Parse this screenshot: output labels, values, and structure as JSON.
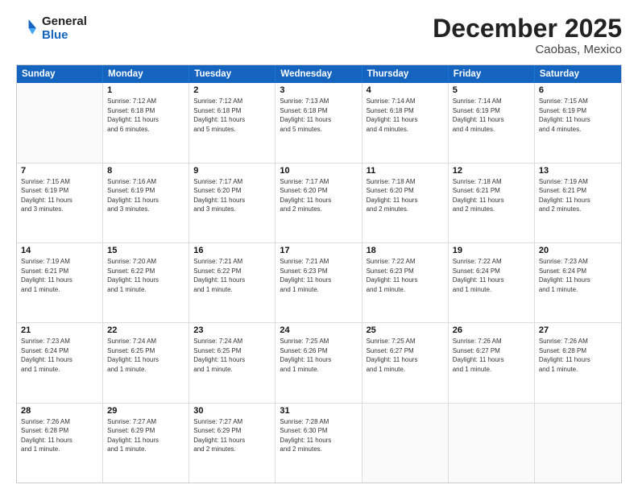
{
  "logo": {
    "line1": "General",
    "line2": "Blue"
  },
  "title": "December 2025",
  "subtitle": "Caobas, Mexico",
  "header_days": [
    "Sunday",
    "Monday",
    "Tuesday",
    "Wednesday",
    "Thursday",
    "Friday",
    "Saturday"
  ],
  "weeks": [
    [
      {
        "day": "",
        "lines": []
      },
      {
        "day": "1",
        "lines": [
          "Sunrise: 7:12 AM",
          "Sunset: 6:18 PM",
          "Daylight: 11 hours",
          "and 6 minutes."
        ]
      },
      {
        "day": "2",
        "lines": [
          "Sunrise: 7:12 AM",
          "Sunset: 6:18 PM",
          "Daylight: 11 hours",
          "and 5 minutes."
        ]
      },
      {
        "day": "3",
        "lines": [
          "Sunrise: 7:13 AM",
          "Sunset: 6:18 PM",
          "Daylight: 11 hours",
          "and 5 minutes."
        ]
      },
      {
        "day": "4",
        "lines": [
          "Sunrise: 7:14 AM",
          "Sunset: 6:18 PM",
          "Daylight: 11 hours",
          "and 4 minutes."
        ]
      },
      {
        "day": "5",
        "lines": [
          "Sunrise: 7:14 AM",
          "Sunset: 6:19 PM",
          "Daylight: 11 hours",
          "and 4 minutes."
        ]
      },
      {
        "day": "6",
        "lines": [
          "Sunrise: 7:15 AM",
          "Sunset: 6:19 PM",
          "Daylight: 11 hours",
          "and 4 minutes."
        ]
      }
    ],
    [
      {
        "day": "7",
        "lines": [
          "Sunrise: 7:15 AM",
          "Sunset: 6:19 PM",
          "Daylight: 11 hours",
          "and 3 minutes."
        ]
      },
      {
        "day": "8",
        "lines": [
          "Sunrise: 7:16 AM",
          "Sunset: 6:19 PM",
          "Daylight: 11 hours",
          "and 3 minutes."
        ]
      },
      {
        "day": "9",
        "lines": [
          "Sunrise: 7:17 AM",
          "Sunset: 6:20 PM",
          "Daylight: 11 hours",
          "and 3 minutes."
        ]
      },
      {
        "day": "10",
        "lines": [
          "Sunrise: 7:17 AM",
          "Sunset: 6:20 PM",
          "Daylight: 11 hours",
          "and 2 minutes."
        ]
      },
      {
        "day": "11",
        "lines": [
          "Sunrise: 7:18 AM",
          "Sunset: 6:20 PM",
          "Daylight: 11 hours",
          "and 2 minutes."
        ]
      },
      {
        "day": "12",
        "lines": [
          "Sunrise: 7:18 AM",
          "Sunset: 6:21 PM",
          "Daylight: 11 hours",
          "and 2 minutes."
        ]
      },
      {
        "day": "13",
        "lines": [
          "Sunrise: 7:19 AM",
          "Sunset: 6:21 PM",
          "Daylight: 11 hours",
          "and 2 minutes."
        ]
      }
    ],
    [
      {
        "day": "14",
        "lines": [
          "Sunrise: 7:19 AM",
          "Sunset: 6:21 PM",
          "Daylight: 11 hours",
          "and 1 minute."
        ]
      },
      {
        "day": "15",
        "lines": [
          "Sunrise: 7:20 AM",
          "Sunset: 6:22 PM",
          "Daylight: 11 hours",
          "and 1 minute."
        ]
      },
      {
        "day": "16",
        "lines": [
          "Sunrise: 7:21 AM",
          "Sunset: 6:22 PM",
          "Daylight: 11 hours",
          "and 1 minute."
        ]
      },
      {
        "day": "17",
        "lines": [
          "Sunrise: 7:21 AM",
          "Sunset: 6:23 PM",
          "Daylight: 11 hours",
          "and 1 minute."
        ]
      },
      {
        "day": "18",
        "lines": [
          "Sunrise: 7:22 AM",
          "Sunset: 6:23 PM",
          "Daylight: 11 hours",
          "and 1 minute."
        ]
      },
      {
        "day": "19",
        "lines": [
          "Sunrise: 7:22 AM",
          "Sunset: 6:24 PM",
          "Daylight: 11 hours",
          "and 1 minute."
        ]
      },
      {
        "day": "20",
        "lines": [
          "Sunrise: 7:23 AM",
          "Sunset: 6:24 PM",
          "Daylight: 11 hours",
          "and 1 minute."
        ]
      }
    ],
    [
      {
        "day": "21",
        "lines": [
          "Sunrise: 7:23 AM",
          "Sunset: 6:24 PM",
          "Daylight: 11 hours",
          "and 1 minute."
        ]
      },
      {
        "day": "22",
        "lines": [
          "Sunrise: 7:24 AM",
          "Sunset: 6:25 PM",
          "Daylight: 11 hours",
          "and 1 minute."
        ]
      },
      {
        "day": "23",
        "lines": [
          "Sunrise: 7:24 AM",
          "Sunset: 6:25 PM",
          "Daylight: 11 hours",
          "and 1 minute."
        ]
      },
      {
        "day": "24",
        "lines": [
          "Sunrise: 7:25 AM",
          "Sunset: 6:26 PM",
          "Daylight: 11 hours",
          "and 1 minute."
        ]
      },
      {
        "day": "25",
        "lines": [
          "Sunrise: 7:25 AM",
          "Sunset: 6:27 PM",
          "Daylight: 11 hours",
          "and 1 minute."
        ]
      },
      {
        "day": "26",
        "lines": [
          "Sunrise: 7:26 AM",
          "Sunset: 6:27 PM",
          "Daylight: 11 hours",
          "and 1 minute."
        ]
      },
      {
        "day": "27",
        "lines": [
          "Sunrise: 7:26 AM",
          "Sunset: 6:28 PM",
          "Daylight: 11 hours",
          "and 1 minute."
        ]
      }
    ],
    [
      {
        "day": "28",
        "lines": [
          "Sunrise: 7:26 AM",
          "Sunset: 6:28 PM",
          "Daylight: 11 hours",
          "and 1 minute."
        ]
      },
      {
        "day": "29",
        "lines": [
          "Sunrise: 7:27 AM",
          "Sunset: 6:29 PM",
          "Daylight: 11 hours",
          "and 1 minute."
        ]
      },
      {
        "day": "30",
        "lines": [
          "Sunrise: 7:27 AM",
          "Sunset: 6:29 PM",
          "Daylight: 11 hours",
          "and 2 minutes."
        ]
      },
      {
        "day": "31",
        "lines": [
          "Sunrise: 7:28 AM",
          "Sunset: 6:30 PM",
          "Daylight: 11 hours",
          "and 2 minutes."
        ]
      },
      {
        "day": "",
        "lines": []
      },
      {
        "day": "",
        "lines": []
      },
      {
        "day": "",
        "lines": []
      }
    ]
  ]
}
